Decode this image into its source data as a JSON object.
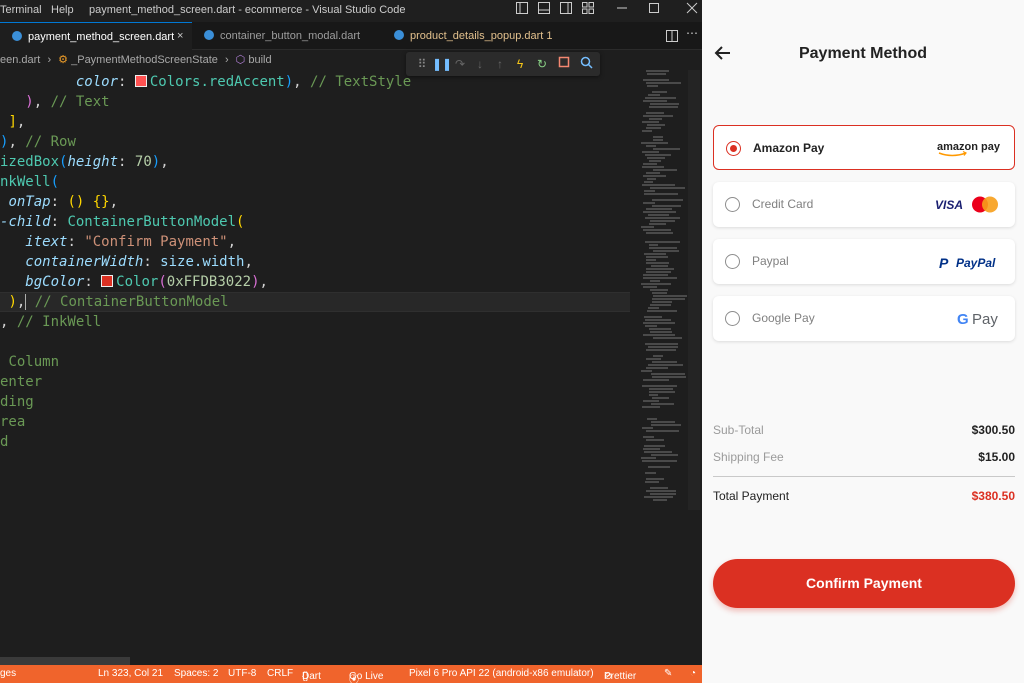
{
  "vscode": {
    "menu": [
      "Terminal",
      "Help"
    ],
    "window_title": "payment_method_screen.dart - ecommerce - Visual Studio Code",
    "tabs": [
      {
        "label": "payment_method_screen.dart",
        "close": "×",
        "active": true
      },
      {
        "label": "container_button_modal.dart",
        "active": false
      },
      {
        "label": "product_details_popup.dart 1",
        "active": false
      }
    ],
    "breadcrumb": {
      "file": "een.dart",
      "class": "_PaymentMethodScreenState",
      "method": "build"
    },
    "code": {
      "l1_prop": "color",
      "l1_val": "Colors.redAccent",
      "l1_comment": "// TextStyle",
      "l2_comment": "// Text",
      "l4_comment": "// Row",
      "l5_widget": "izedBox",
      "l5_prop": "height",
      "l5_num": "70",
      "l6_widget": "nkWell",
      "l7_prop": "onTap",
      "l8_prop": "child",
      "l8_widget": "ContainerButtonModel",
      "l9_prop": "itext",
      "l9_str": "\"Confirm Payment\"",
      "l10_prop": "containerWidth",
      "l10_val": "size.width",
      "l11_prop": "bgColor",
      "l11_fn": "Color",
      "l11_num": "0xFFDB3022",
      "l12_comment": "// ContainerButtonModel",
      "l13_comment": "// InkWell",
      "l15": "Column",
      "l16": "enter",
      "l17": "ding",
      "l18": "rea",
      "l19": "d"
    },
    "status": {
      "left": "ges",
      "position": "Ln 323, Col 21",
      "spaces": "Spaces: 2",
      "encoding": "UTF-8",
      "eol": "CRLF",
      "language": "Dart",
      "golive": "Go Live",
      "device": "Pixel 6 Pro API 22 (android-x86 emulator)",
      "prettier": "Prettier"
    }
  },
  "app": {
    "title": "Payment Method",
    "methods": [
      {
        "label": "Amazon Pay",
        "brand": "amazon pay",
        "selected": true
      },
      {
        "label": "Credit Card",
        "brand": "VISA",
        "selected": false
      },
      {
        "label": "Paypal",
        "brand": "PayPal",
        "selected": false
      },
      {
        "label": "Google Pay",
        "brand": "Pay",
        "selected": false
      }
    ],
    "summary": {
      "subtotal_label": "Sub-Total",
      "subtotal_value": "$300.50",
      "shipping_label": "Shipping Fee",
      "shipping_value": "$15.00",
      "total_label": "Total Payment",
      "total_value": "$380.50"
    },
    "confirm_label": "Confirm Payment",
    "colors": {
      "accent": "#DB3022",
      "text": "#222222",
      "muted": "#9B9B9B"
    }
  }
}
